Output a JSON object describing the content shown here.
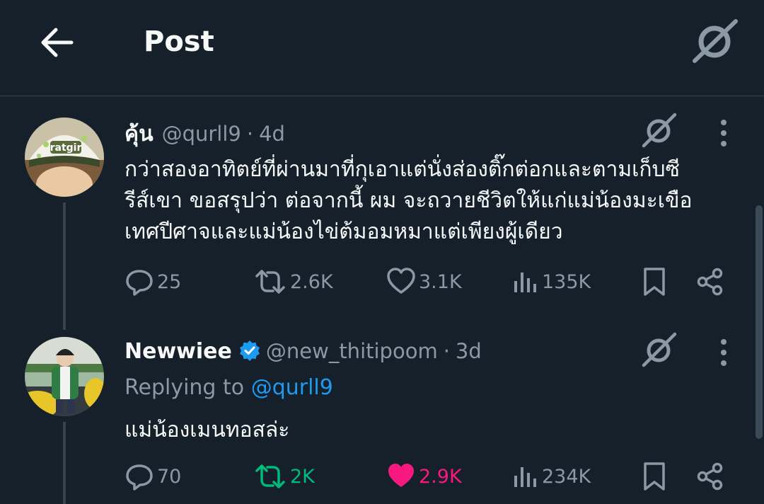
{
  "header": {
    "title": "Post"
  },
  "colors": {
    "background": "#15202b",
    "secondary_text": "#8b98a5",
    "link": "#1d9bf0",
    "retweet_active": "#00ba7c",
    "like_active": "#f91880"
  },
  "tweets": [
    {
      "name": "คุ้น",
      "handle": "@qurll9",
      "time": "4d",
      "avatar_text": "ratgir",
      "text_lines": [
        "กว่าสองอาทิตย์ที่ผ่านมาที่กุเอาแต่นั่งส่องติ๊กต่อกและตามเก็บซี",
        "รีส์เขา ขอสรุปว่า ต่อจากนี้ ผม จะถวายชีวิตให้แก่แม่น้องมะเขือ",
        "เทศปีศาจและแม่น้องไข่ต้มอมหมาแต่เพียงผู้เดียว"
      ],
      "stats": {
        "replies": "25",
        "reposts": "2.6K",
        "likes": "3.1K",
        "views": "135K"
      }
    },
    {
      "name": "Newwiee",
      "handle": "@new_thitipoom",
      "time": "3d",
      "verified": true,
      "replying_prefix": "Replying to",
      "replying_handle": "@qurll9",
      "text": "แม่น้องเมนทอสล่ะ",
      "stats": {
        "replies": "70",
        "reposts": "2K",
        "likes": "2.9K",
        "views": "234K"
      },
      "reposted": true,
      "liked": true
    }
  ],
  "separator": "·"
}
